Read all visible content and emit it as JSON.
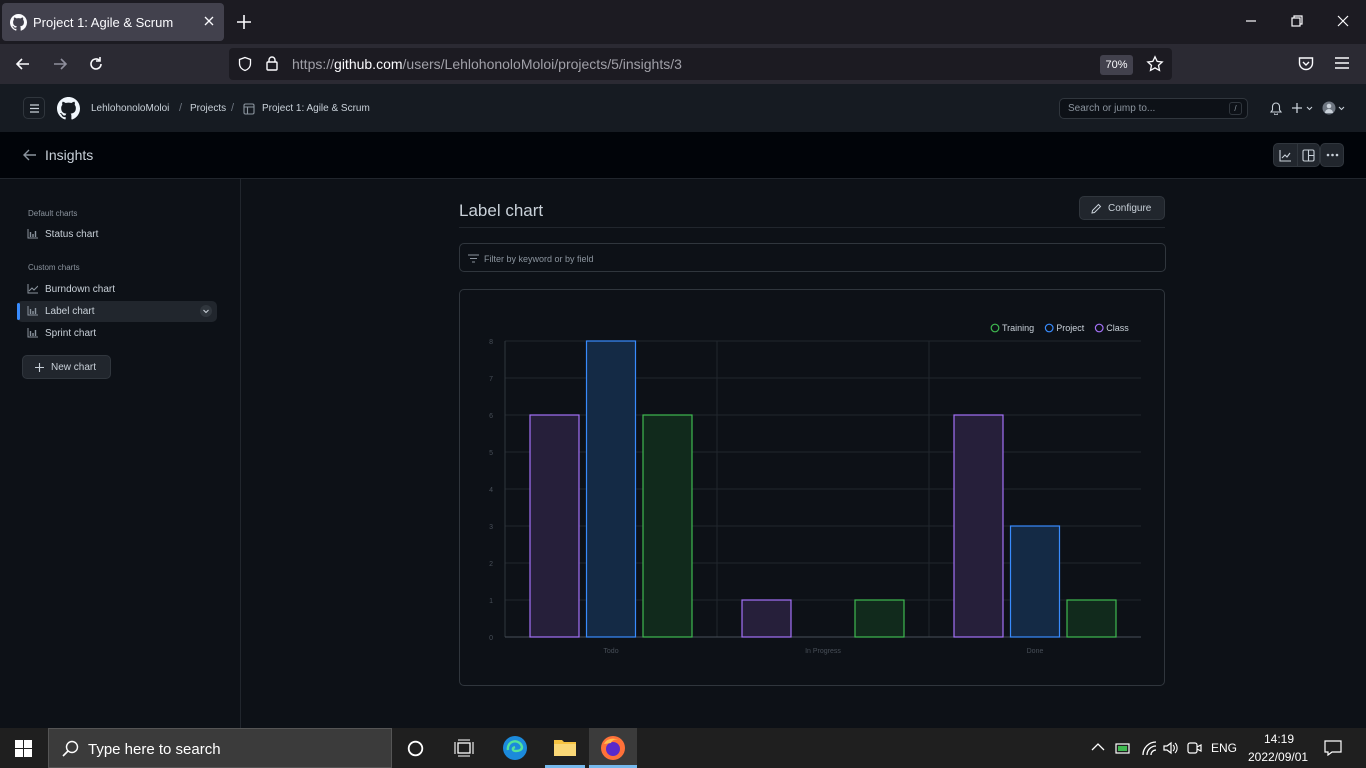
{
  "browser": {
    "tab_title": "Project 1: Agile & Scrum",
    "url_domain": "github.com",
    "url_prefix": "https://",
    "url_path": "/users/LehlohonoloMoloi/projects/5/insights/3",
    "zoom": "70%"
  },
  "github": {
    "breadcrumb_user": "LehlohonoloMoloi",
    "breadcrumb_projects": "Projects",
    "breadcrumb_project": "Project 1: Agile & Scrum",
    "search_placeholder": "Search or jump to...",
    "search_kbd": "/"
  },
  "insights": {
    "title": "Insights"
  },
  "sidebar": {
    "default_heading": "Default charts",
    "default_items": [
      {
        "label": "Status chart"
      }
    ],
    "custom_heading": "Custom charts",
    "custom_items": [
      {
        "label": "Burndown chart"
      },
      {
        "label": "Label chart"
      },
      {
        "label": "Sprint chart"
      }
    ],
    "new_chart": "New chart"
  },
  "main": {
    "chart_title": "Label chart",
    "configure": "Configure",
    "filter_placeholder": "Filter by keyword or by field"
  },
  "colors": {
    "training": "#3fb950",
    "project": "#388bfd",
    "class": "#a371f7",
    "accent": "#388bfd"
  },
  "chart_data": {
    "type": "bar",
    "categories": [
      "Todo",
      "In Progress",
      "Done"
    ],
    "series": [
      {
        "name": "Class",
        "values": [
          6,
          1,
          6
        ]
      },
      {
        "name": "Project",
        "values": [
          8,
          0,
          3
        ]
      },
      {
        "name": "Training",
        "values": [
          6,
          1,
          1
        ]
      }
    ],
    "legend": [
      "Training",
      "Project",
      "Class"
    ],
    "legend_position": "top-right",
    "ylim": [
      0,
      8
    ],
    "yticks": [
      "0",
      "1",
      "2",
      "3",
      "4",
      "5",
      "6",
      "7",
      "8"
    ],
    "grid": true
  },
  "taskbar": {
    "search_placeholder": "Type here to search",
    "lang": "ENG",
    "time": "14:19",
    "date": "2022/09/01"
  }
}
